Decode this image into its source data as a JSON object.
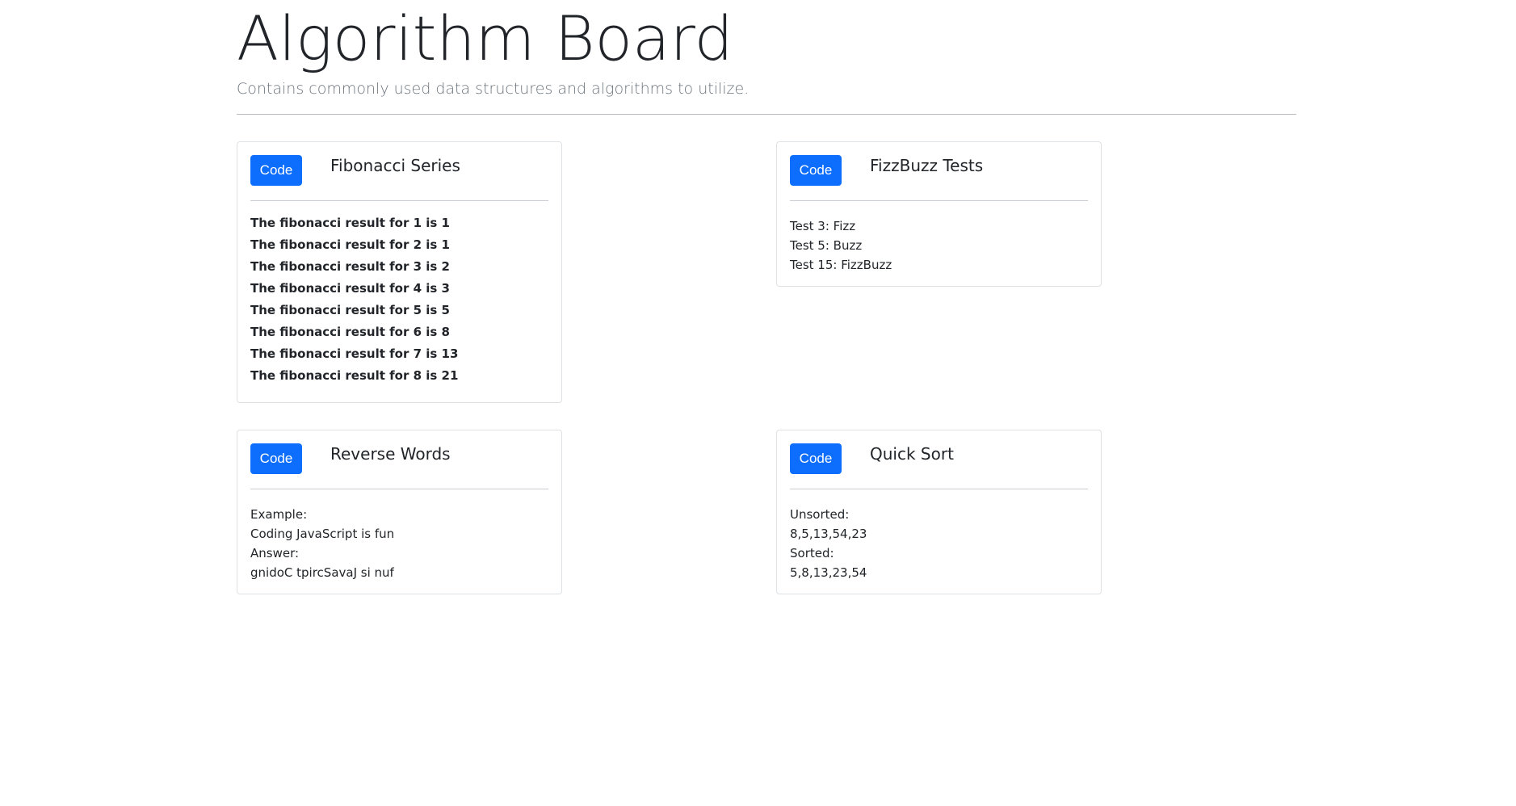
{
  "header": {
    "title": "Algorithm Board",
    "subtitle": "Contains commonly used data structures and algorithms to utilize."
  },
  "colors": {
    "primary_button": "#0d6efd",
    "text": "#212529",
    "muted": "#6c757d"
  },
  "cards": {
    "fibonacci": {
      "button_label": "Code",
      "title": "Fibonacci Series",
      "lines": [
        "The fibonacci result for 1 is 1",
        "The fibonacci result for 2 is 1",
        "The fibonacci result for 3 is 2",
        "The fibonacci result for 4 is 3",
        "The fibonacci result for 5 is 5",
        "The fibonacci result for 6 is 8",
        "The fibonacci result for 7 is 13",
        "The fibonacci result for 8 is 21"
      ]
    },
    "fizzbuzz": {
      "button_label": "Code",
      "title": "FizzBuzz Tests",
      "lines": [
        "Test 3: Fizz",
        "Test 5: Buzz",
        "Test 15: FizzBuzz"
      ]
    },
    "reverse_words": {
      "button_label": "Code",
      "title": "Reverse Words",
      "lines": [
        "Example:",
        "Coding JavaScript is fun",
        "Answer:",
        "gnidoC tpircSavaJ si nuf"
      ]
    },
    "quick_sort": {
      "button_label": "Code",
      "title": "Quick Sort",
      "lines": [
        "Unsorted:",
        "8,5,13,54,23",
        "Sorted:",
        "5,8,13,23,54"
      ]
    }
  }
}
